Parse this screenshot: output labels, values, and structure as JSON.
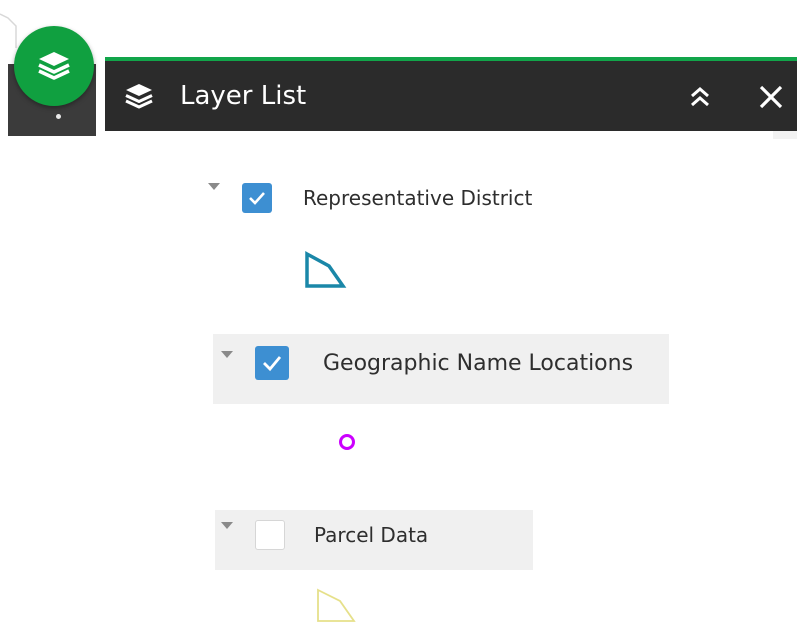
{
  "panel": {
    "title": "Layer List",
    "accent_color": "#12a54a",
    "header_color": "#2b2b2b"
  },
  "launcher": {
    "icon": "layers-icon",
    "color": "#10a040"
  },
  "header_actions": {
    "collapse_icon": "double-chevron-up-icon",
    "close_icon": "close-icon"
  },
  "layers": [
    {
      "label": "Representative District",
      "checked": true,
      "expanded": true,
      "legend_symbol": "polygon",
      "legend_color": "#1a87a8"
    },
    {
      "label": "Geographic Name Locations",
      "checked": true,
      "expanded": true,
      "legend_symbol": "circle",
      "legend_color": "#cc00ff"
    },
    {
      "label": "Parcel Data",
      "checked": false,
      "expanded": true,
      "legend_symbol": "polygon",
      "legend_color": "#e6e08a"
    }
  ]
}
